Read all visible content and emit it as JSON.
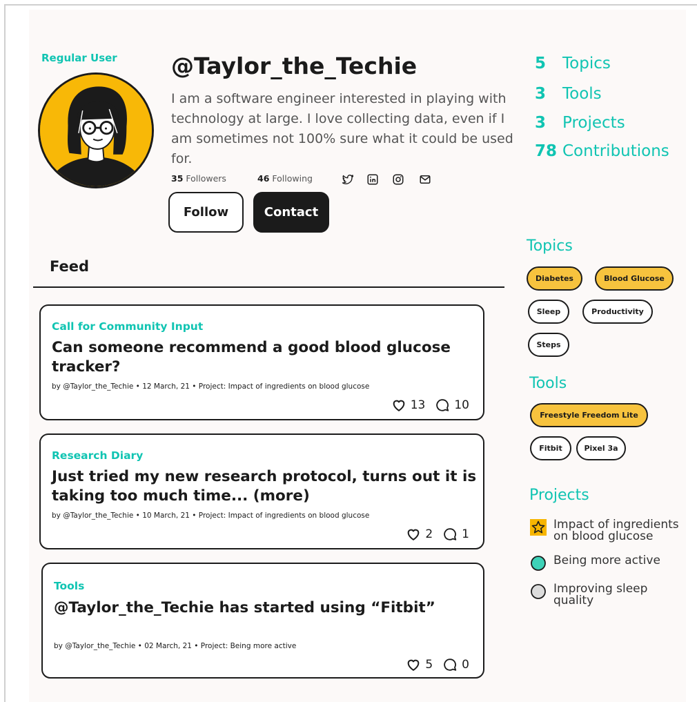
{
  "profile": {
    "role": "Regular User",
    "username": "@Taylor_the_Techie",
    "bio": "I am a software engineer interested in playing with technology at large. I love collecting data, even if I am sometimes not 100% sure what it could be used for.",
    "followers_count": "35",
    "followers_label": "Followers",
    "following_count": "46",
    "following_label": "Following",
    "follow_button": "Follow",
    "contact_button": "Contact",
    "social_icons": [
      "twitter-icon",
      "linkedin-icon",
      "instagram-icon",
      "mail-icon"
    ]
  },
  "counts": [
    {
      "num": "5",
      "label": "Topics"
    },
    {
      "num": "3",
      "label": "Tools"
    },
    {
      "num": "3",
      "label": "Projects"
    },
    {
      "num": "78",
      "label": "Contributions"
    }
  ],
  "feed": {
    "title": "Feed",
    "posts": [
      {
        "category": "Call for Community Input",
        "title": "Can someone recommend a good blood glucose tracker?",
        "meta": "by @Taylor_the_Techie  •  12 March, 21 •  Project: Impact of ingredients on blood glucose",
        "likes": "13",
        "comments": "10"
      },
      {
        "category": "Research Diary",
        "title": "Just tried my new research protocol, turns out it is taking too much time... (more)",
        "meta": "by @Taylor_the_Techie  •  10 March, 21 •  Project: Impact of ingredients on blood glucose",
        "likes": "2",
        "comments": "1"
      },
      {
        "category": "Tools",
        "title": "@Taylor_the_Techie has started using “Fitbit”",
        "meta": "by @Taylor_the_Techie  •  02 March, 21 •  Project: Being more active",
        "likes": "5",
        "comments": "0"
      }
    ]
  },
  "topics": {
    "heading": "Topics",
    "items": [
      "Diabetes",
      "Blood Glucose",
      "Sleep",
      "Productivity",
      "Steps"
    ],
    "highlighted": [
      "Diabetes",
      "Blood Glucose"
    ]
  },
  "tools": {
    "heading": "Tools",
    "items": [
      "Freestyle Freedom Lite",
      "Fitbit",
      "Pixel 3a"
    ],
    "highlighted": [
      "Freestyle Freedom Lite"
    ]
  },
  "projects": {
    "heading": "Projects",
    "items": [
      {
        "line1": "Impact of ingredients",
        "line2": "on blood glucose",
        "marker": "star-icon"
      },
      {
        "line1": "Being more active",
        "line2": "",
        "marker": "teal-circle-icon"
      },
      {
        "line1": "Improving sleep",
        "line2": "quality",
        "marker": "gray-circle-icon"
      }
    ]
  },
  "colors": {
    "accent": "#10c4b2",
    "highlight": "#f7c33e",
    "avatar_bg": "#f8b807",
    "dark": "#1b1b1b"
  }
}
